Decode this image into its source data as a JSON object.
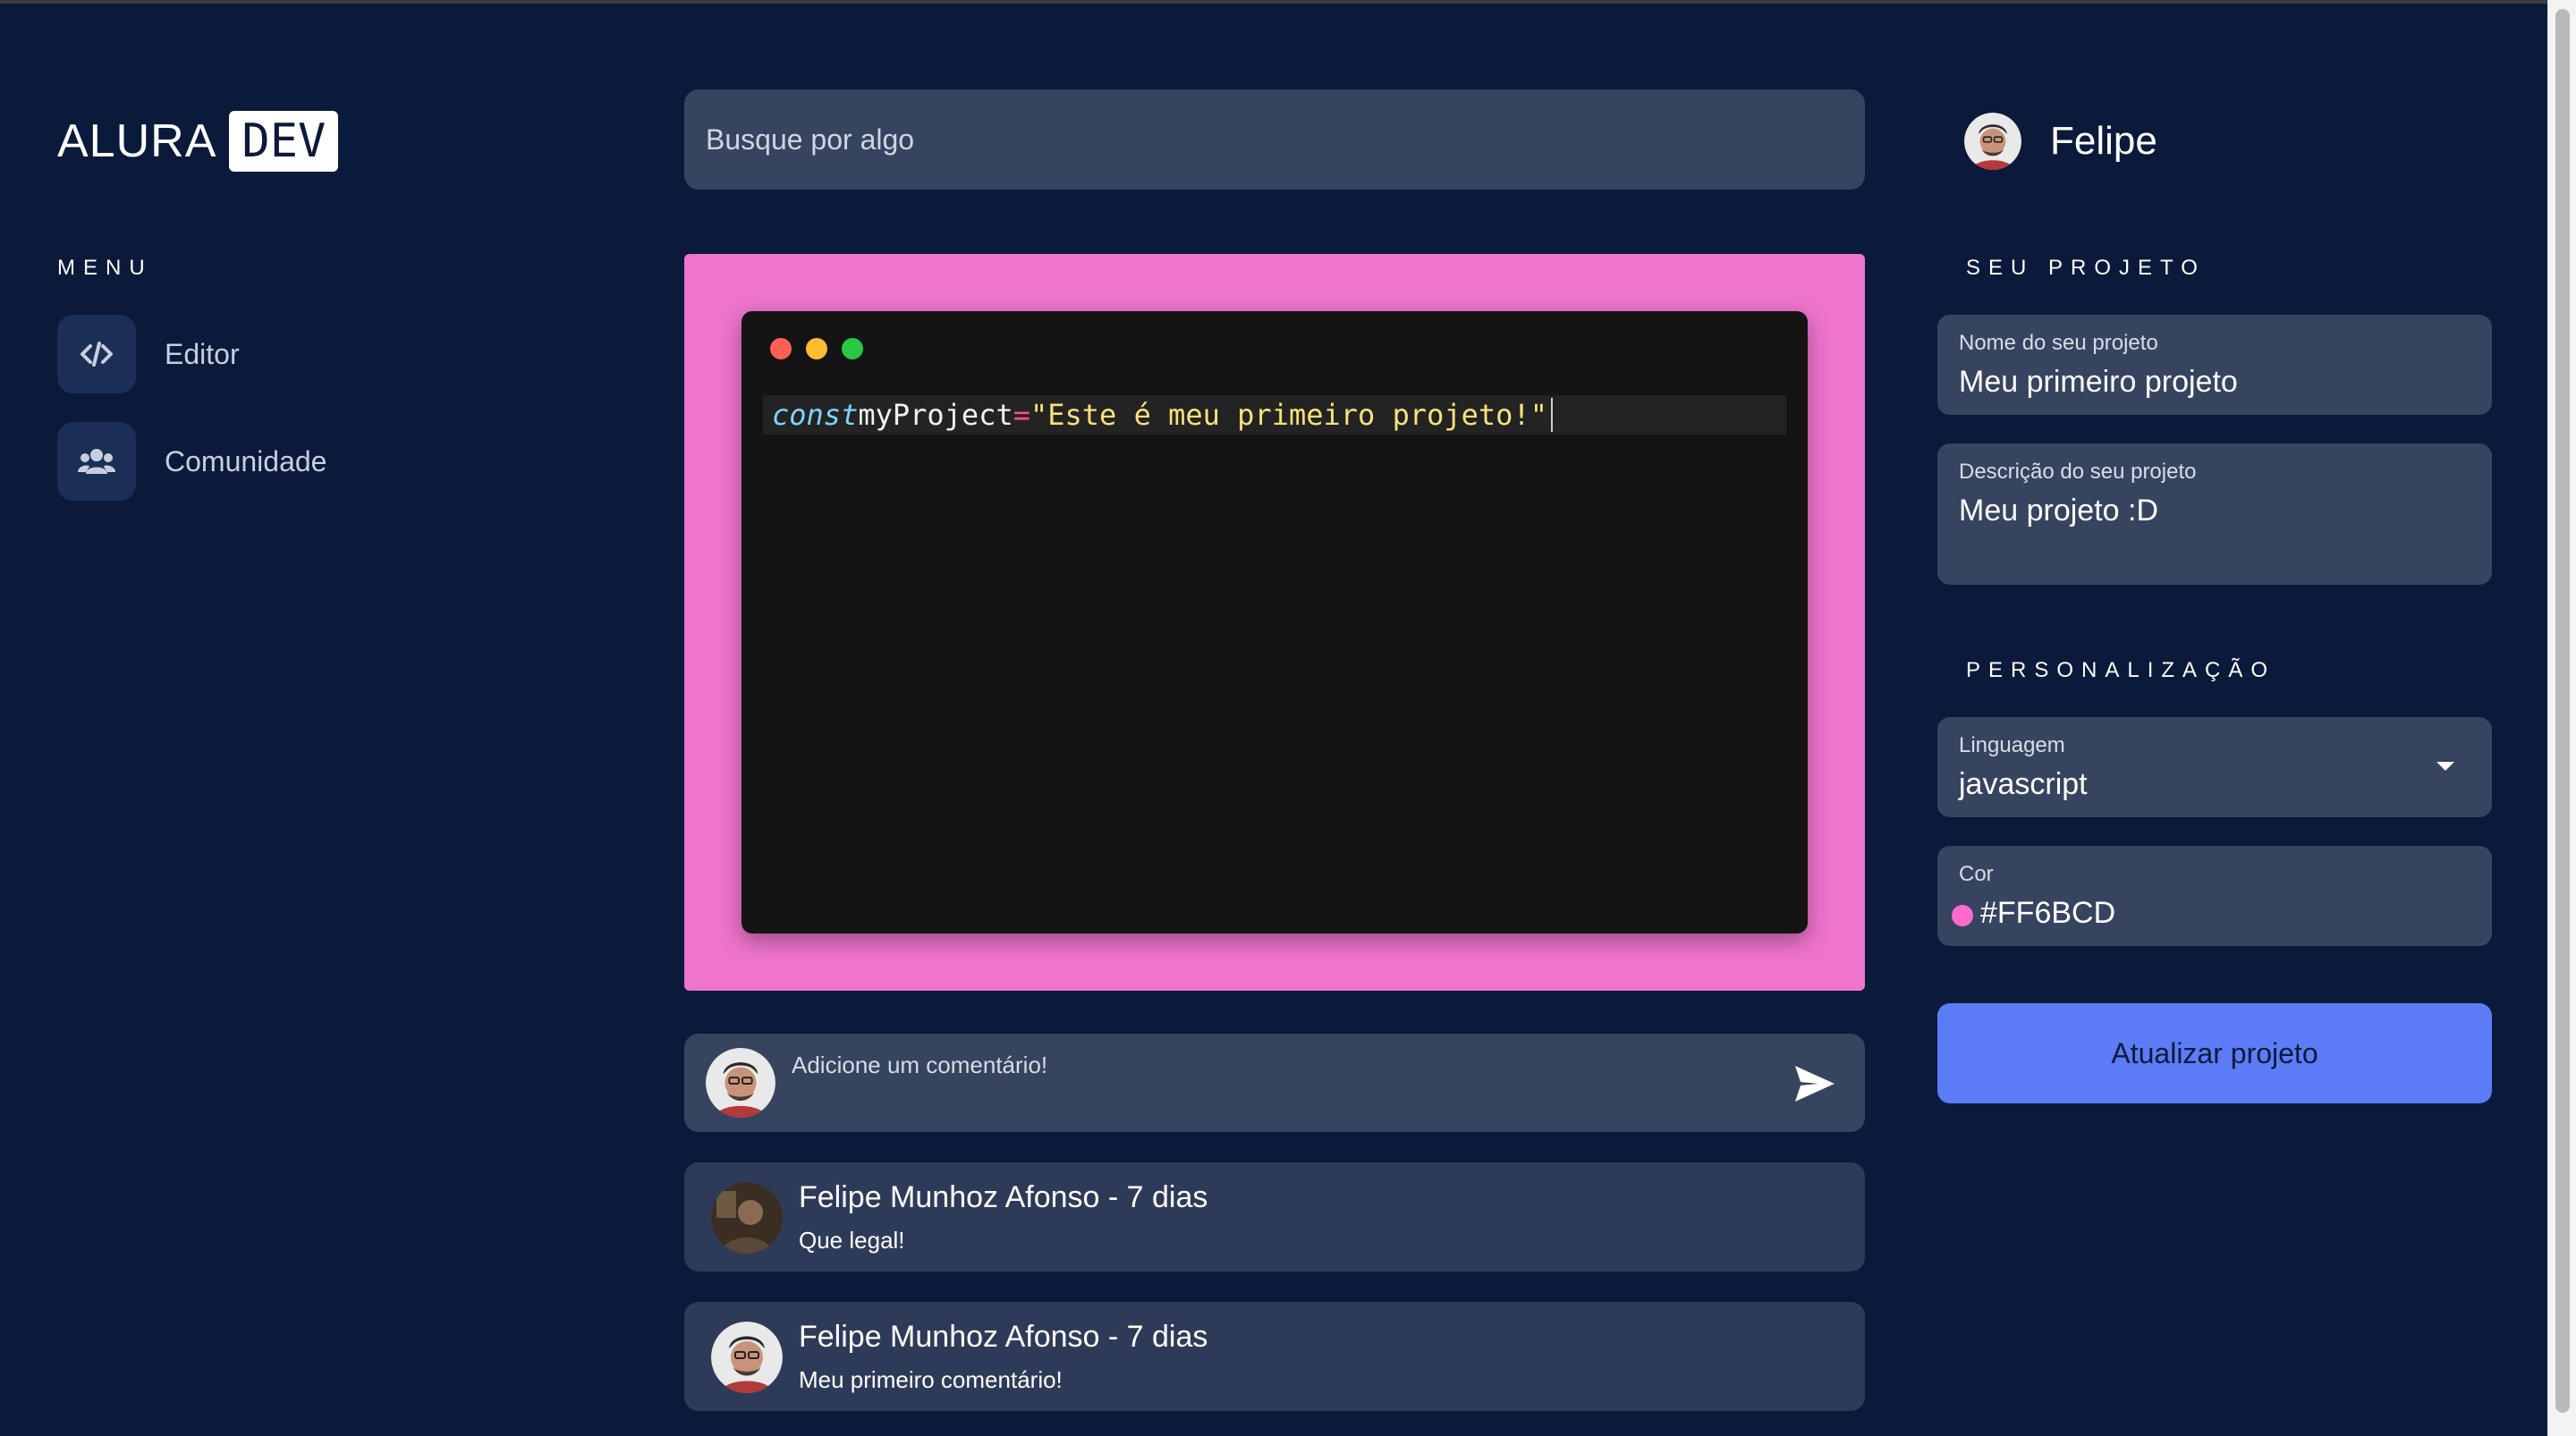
{
  "logo": {
    "text": "ALURA",
    "badge": "DEV"
  },
  "menu": {
    "title": "MENU",
    "items": [
      {
        "label": "Editor",
        "icon": "code-icon"
      },
      {
        "label": "Comunidade",
        "icon": "users-icon"
      }
    ]
  },
  "search": {
    "placeholder": "Busque por algo"
  },
  "editor": {
    "window_dots": [
      "#ff5f57",
      "#febc2e",
      "#28c840"
    ],
    "code": {
      "keyword": "const",
      "identifier": "myProject",
      "operator": "=",
      "string": "\"Este é meu primeiro projeto!\""
    },
    "background_color": "#ee74cc"
  },
  "comment_input": {
    "placeholder": "Adicione um comentário!"
  },
  "comments": [
    {
      "author": "Felipe Munhoz Afonso - 7 dias",
      "text": "Que legal!"
    },
    {
      "author": "Felipe Munhoz Afonso - 7 dias",
      "text": "Meu primeiro comentário!"
    }
  ],
  "user": {
    "name": "Felipe"
  },
  "project": {
    "title": "SEU PROJETO",
    "name_label": "Nome do seu projeto",
    "name_value": "Meu primeiro projeto",
    "desc_label": "Descrição do seu projeto",
    "desc_value": "Meu projeto :D"
  },
  "customization": {
    "title": "PERSONALIZAÇÃO",
    "language_label": "Linguagem",
    "language_value": "javascript",
    "color_label": "Cor",
    "color_value": "#FF6BCD"
  },
  "update_button": {
    "label": "Atualizar projeto"
  },
  "colors": {
    "background": "#0b1a3a",
    "field": "#374460",
    "accent": "#5b7cf6",
    "pink": "#ee74cc"
  }
}
